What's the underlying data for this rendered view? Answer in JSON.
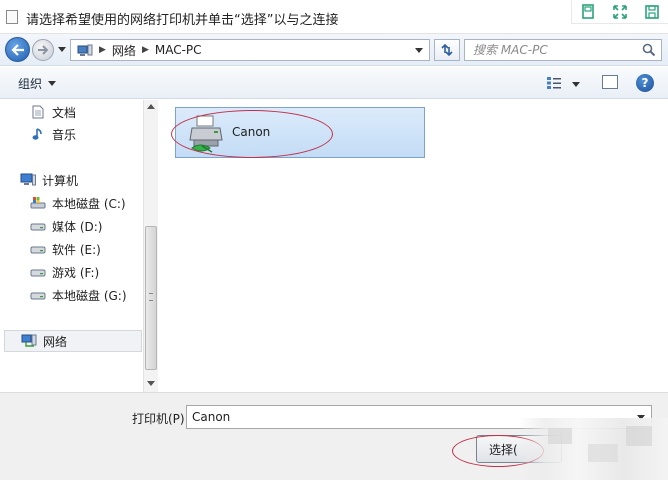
{
  "window": {
    "title": "请选择希望使用的网络打印机并单击“选择”以与之连接"
  },
  "address_bar": {
    "crumbs": [
      "网络",
      "MAC-PC"
    ]
  },
  "search": {
    "placeholder": "搜索 MAC-PC"
  },
  "toolbar": {
    "organize_label": "组织",
    "help_label": "?"
  },
  "nav_pane": {
    "items": [
      {
        "label": "文档",
        "icon": "document-icon"
      },
      {
        "label": "音乐",
        "icon": "music-note-icon"
      },
      {
        "label": "计算机",
        "icon": "computer-icon"
      },
      {
        "label": "本地磁盘 (C:)",
        "icon": "system-drive-icon"
      },
      {
        "label": "媒体 (D:)",
        "icon": "drive-icon"
      },
      {
        "label": "软件 (E:)",
        "icon": "drive-icon"
      },
      {
        "label": "游戏 (F:)",
        "icon": "drive-icon"
      },
      {
        "label": "本地磁盘 (G:)",
        "icon": "drive-icon"
      },
      {
        "label": "网络",
        "icon": "network-icon",
        "selected": true
      }
    ]
  },
  "content": {
    "printers": [
      {
        "name": "Canon",
        "icon": "network-printer-icon",
        "selected": true
      }
    ]
  },
  "bottom": {
    "printer_label": "打印机(P):",
    "printer_value": "Canon",
    "select_button": "选择("
  },
  "colors": {
    "selection_fill": "#cfe3f8",
    "selection_border": "#7da2ce",
    "annotation": "#c0304a"
  }
}
